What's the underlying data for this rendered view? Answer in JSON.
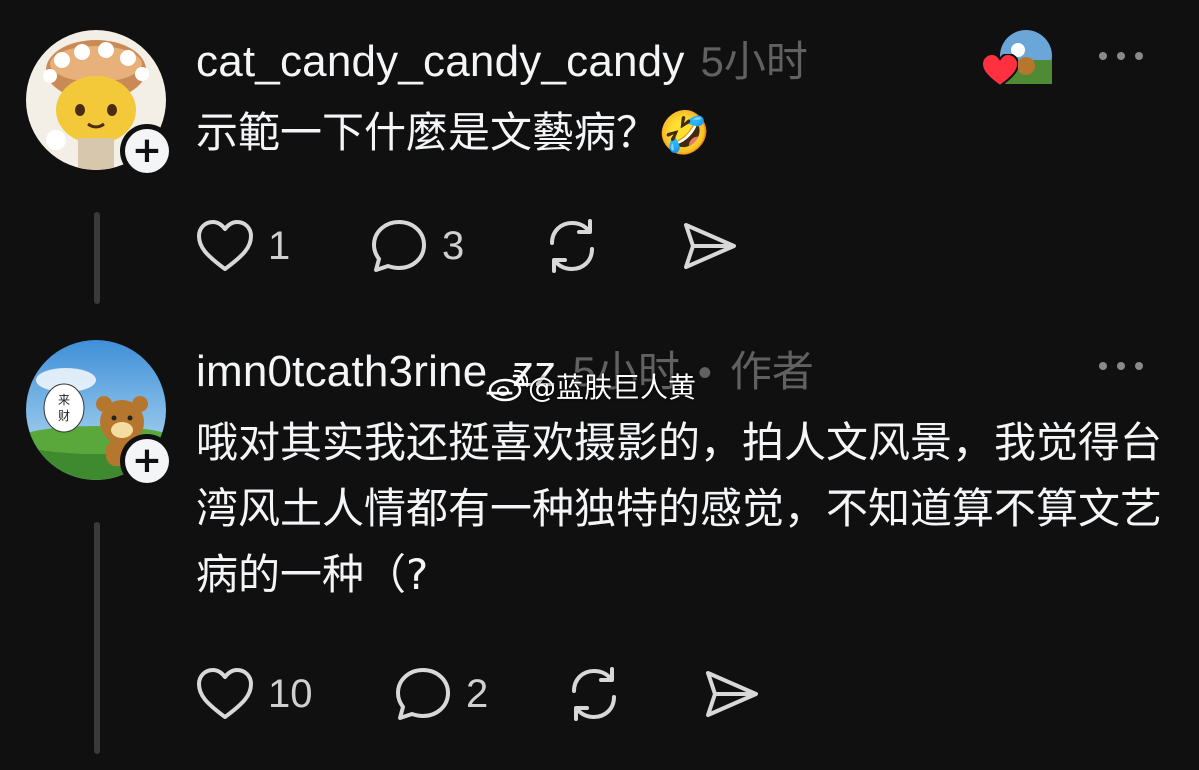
{
  "posts": [
    {
      "username": "cat_candy_candy_candy",
      "time": "5小时",
      "text": "示範一下什麼是文藝病？🤣",
      "likes": "1",
      "replies": "3"
    },
    {
      "username": "imn0tcath3rine_zz",
      "time": "5小时",
      "separator": "•",
      "author_tag": "作者",
      "avatar_sign_text": "来\n财",
      "text": "哦对其实我还挺喜欢摄影的，拍人文风景，我觉得台湾风土人情都有一种独特的感觉，不知道算不算文艺病的一种（?",
      "likes": "10",
      "replies": "2"
    }
  ],
  "watermark": {
    "text": "@蓝肤巨人黄"
  },
  "colors": {
    "background": "#101010",
    "primary_text": "#f3f5f7",
    "secondary_text": "#616161",
    "heart_red": "#ff3040"
  }
}
